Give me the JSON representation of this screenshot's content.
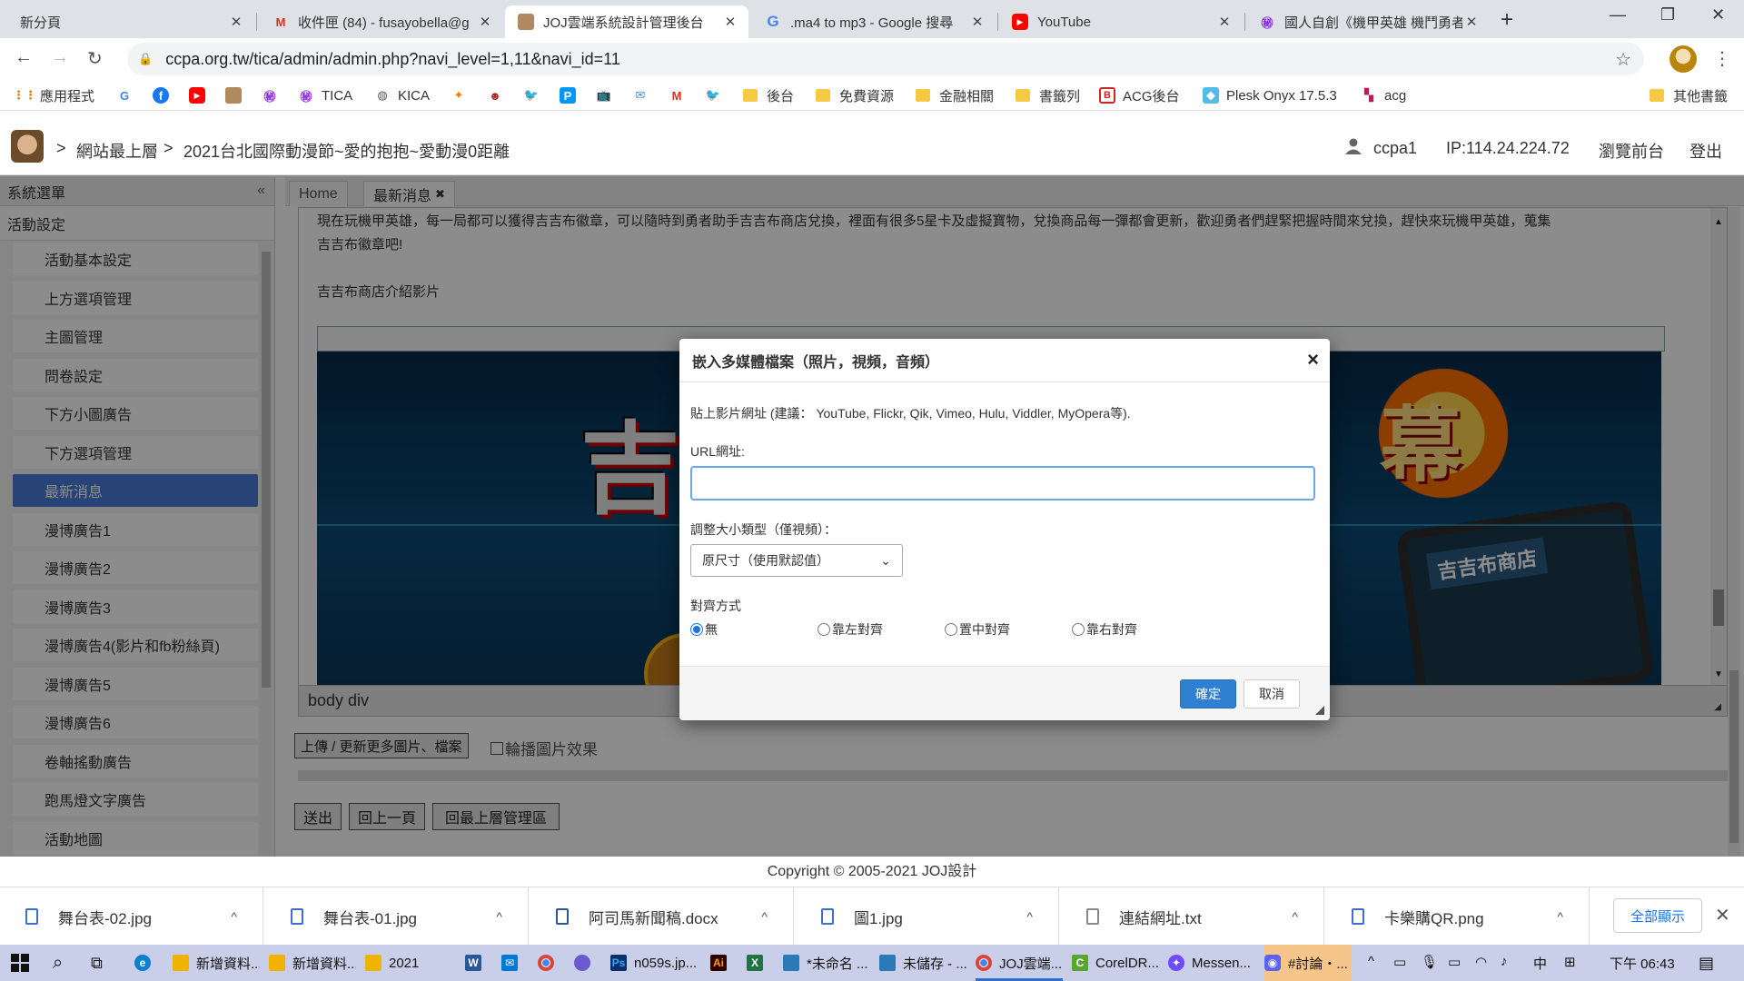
{
  "browser": {
    "tabs": [
      {
        "title": "新分頁",
        "favicon": "blank-icon"
      },
      {
        "title": "收件匣 (84) - fusayobella@g",
        "favicon": "gmail-icon"
      },
      {
        "title": "JOJ雲端系統設計管理後台",
        "favicon": "joj-logo-icon"
      },
      {
        "title": ".ma4 to mp3 - Google 搜尋",
        "favicon": "google-icon"
      },
      {
        "title": "YouTube",
        "favicon": "youtube-icon"
      },
      {
        "title": "國人自創《機甲英雄 機鬥勇者",
        "favicon": "tica-icon"
      }
    ],
    "url": "ccpa.org.tw/tica/admin/admin.php?navi_level=1,11&navi_id=11",
    "bookmarks": [
      {
        "label": "應用程式"
      },
      {
        "label": ""
      },
      {
        "label": ""
      },
      {
        "label": ""
      },
      {
        "label": ""
      },
      {
        "label": ""
      },
      {
        "label": "TICA"
      },
      {
        "label": "KICA"
      },
      {
        "label": ""
      },
      {
        "label": ""
      },
      {
        "label": ""
      },
      {
        "label": ""
      },
      {
        "label": ""
      },
      {
        "label": ""
      },
      {
        "label": ""
      },
      {
        "label": ""
      },
      {
        "label": "後台"
      },
      {
        "label": "免費資源"
      },
      {
        "label": "金融相關"
      },
      {
        "label": "書籤列"
      },
      {
        "label": "ACG後台"
      },
      {
        "label": "Plesk Onyx 17.5.3"
      },
      {
        "label": "acg"
      },
      {
        "label": "其他書籤"
      }
    ]
  },
  "header": {
    "crumb_sep": ">",
    "crumb_root": "網站最上層",
    "crumb_current": "2021台北國際動漫節~愛的抱抱~愛動漫0距離",
    "user": "ccpa1",
    "ip": "IP:114.24.224.72",
    "browse_front": "瀏覽前台",
    "logout": "登出"
  },
  "sidebar": {
    "title": "系統選單",
    "group": "活動設定",
    "items": [
      {
        "label": "活動基本設定"
      },
      {
        "label": "上方選項管理"
      },
      {
        "label": "主圖管理"
      },
      {
        "label": "問卷設定"
      },
      {
        "label": "下方小圖廣告"
      },
      {
        "label": "下方選項管理"
      },
      {
        "label": "最新消息"
      },
      {
        "label": "漫博廣告1"
      },
      {
        "label": "漫博廣告2"
      },
      {
        "label": "漫博廣告3"
      },
      {
        "label": "漫博廣告4(影片和fb粉絲頁)"
      },
      {
        "label": "漫博廣告5"
      },
      {
        "label": "漫博廣告6"
      },
      {
        "label": "卷軸搖動廣告"
      },
      {
        "label": "跑馬燈文字廣告"
      },
      {
        "label": "活動地圖"
      }
    ],
    "active_index": 6
  },
  "content_tabs": {
    "home": "Home",
    "current": "最新消息"
  },
  "editor": {
    "line1": "現在玩機甲英雄，每一局都可以獲得吉吉布徽章，可以隨時到勇者助手吉吉布商店兌換，裡面有很多5星卡及虛擬寶物，兌換商品每一彈都會更新，歡迎勇者們趕緊把握時間來兌換，趕快來玩機甲英雄，蒐集",
    "line2": "吉吉布徽章吧!",
    "line3": "吉吉布商店介紹影片",
    "banner_left": "吉",
    "banner_right": "幕",
    "banner_shop": "吉吉布商店",
    "path": "body  div",
    "upload_btn": "上傳 / 更新更多圖片、檔案",
    "carousel_label": "輪播圖片效果",
    "submit": "送出",
    "back": "回上一頁",
    "top": "回最上層管理區"
  },
  "copyright": "Copyright © 2005-2021   JOJ設計",
  "modal": {
    "title": "嵌入多媒體檔案（照片，視頻，音頻）",
    "hint": "貼上影片網址 (建議： YouTube, Flickr, Qik, Vimeo, Hulu, Viddler, MyOpera等).",
    "url_label": "URL網址:",
    "url_value": "",
    "size_label": "調整大小類型（僅視頻）：",
    "size_selected": "原尺寸（使用默認值）",
    "align_label": "對齊方式",
    "align_options": [
      "無",
      "靠左對齊",
      "置中對齊",
      "靠右對齊"
    ],
    "align_selected": 0,
    "ok": "確定",
    "cancel": "取消"
  },
  "downloads": [
    {
      "name": "舞台表-02.jpg"
    },
    {
      "name": "舞台表-01.jpg"
    },
    {
      "name": "阿司馬新聞稿.docx"
    },
    {
      "name": "圖1.jpg"
    },
    {
      "name": "連結網址.txt"
    },
    {
      "name": "卡樂購QR.png"
    }
  ],
  "downloads_show_all": "全部顯示",
  "taskbar": {
    "items": [
      {
        "label": "新增資料...",
        "color": "#f0b400"
      },
      {
        "label": "新增資料...",
        "color": "#f0b400"
      },
      {
        "label": "2021",
        "color": "#f0b400"
      },
      {
        "label": "n059s.jp...",
        "color": "#0a2f6b"
      },
      {
        "label": "*未命名 ...",
        "color": "#2a7ab8"
      },
      {
        "label": "未儲存 - ...",
        "color": "#2a7ab8"
      },
      {
        "label": "JOJ雲端...",
        "color": "#db4437"
      },
      {
        "label": "CorelDR...",
        "color": "#5aa532"
      },
      {
        "label": "Messen...",
        "color": "#6f4cff"
      },
      {
        "label": "#討論・...",
        "color": "#5865f2"
      }
    ],
    "ime": "中",
    "clock": "下午 06:43"
  }
}
